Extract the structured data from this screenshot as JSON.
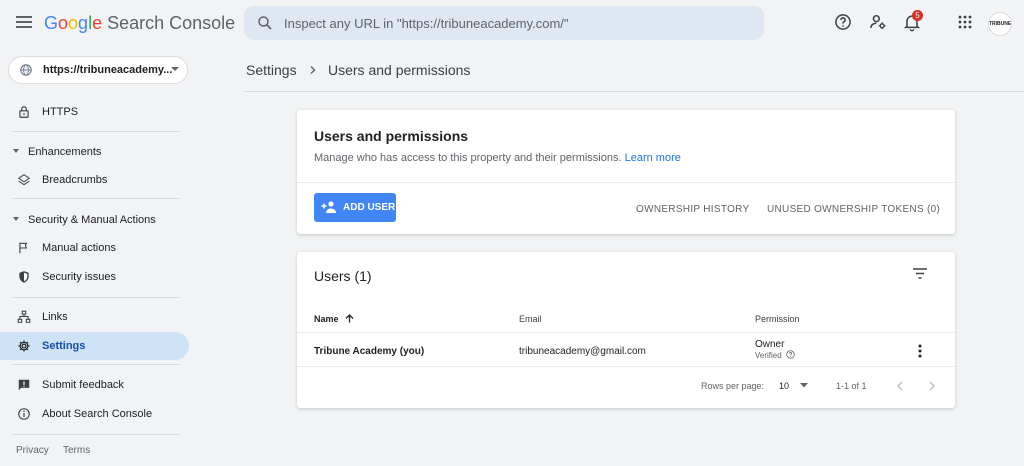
{
  "header": {
    "logo_google": [
      "G",
      "o",
      "o",
      "g",
      "l",
      "e"
    ],
    "product": "Search Console",
    "search_placeholder": "Inspect any URL in \"https://tribuneacademy.com/\"",
    "notification_count": "5",
    "avatar_text": "TRIBUNE"
  },
  "sidebar": {
    "property": "https://tribuneacademy...",
    "items": {
      "https": "HTTPS",
      "enhancements": "Enhancements",
      "breadcrumbs": "Breadcrumbs",
      "security_manual": "Security & Manual Actions",
      "manual_actions": "Manual actions",
      "security_issues": "Security issues",
      "links": "Links",
      "settings": "Settings",
      "submit_feedback": "Submit feedback",
      "about": "About Search Console"
    },
    "footer": {
      "privacy": "Privacy",
      "terms": "Terms"
    }
  },
  "breadcrumb": {
    "parent": "Settings",
    "current": "Users and permissions"
  },
  "permissions_card": {
    "title": "Users and permissions",
    "description": "Manage who has access to this property and their permissions.",
    "learn_more": "Learn more",
    "add_user": "ADD USER",
    "ownership_history": "OWNERSHIP HISTORY",
    "unused_tokens": "UNUSED OWNERSHIP TOKENS (0)"
  },
  "users_card": {
    "title": "Users (1)",
    "columns": {
      "name": "Name",
      "email": "Email",
      "permission": "Permission"
    },
    "rows": [
      {
        "name": "Tribune Academy (you)",
        "email": "tribuneacademy@gmail.com",
        "permission": "Owner",
        "status": "Verified"
      }
    ],
    "pagination": {
      "rows_per_page_label": "Rows per page:",
      "rows_per_page": "10",
      "range": "1-1 of 1"
    }
  },
  "colors": {
    "accent": "#4285f4",
    "active_nav": "#cfe3f7",
    "badge": "#d93025"
  }
}
